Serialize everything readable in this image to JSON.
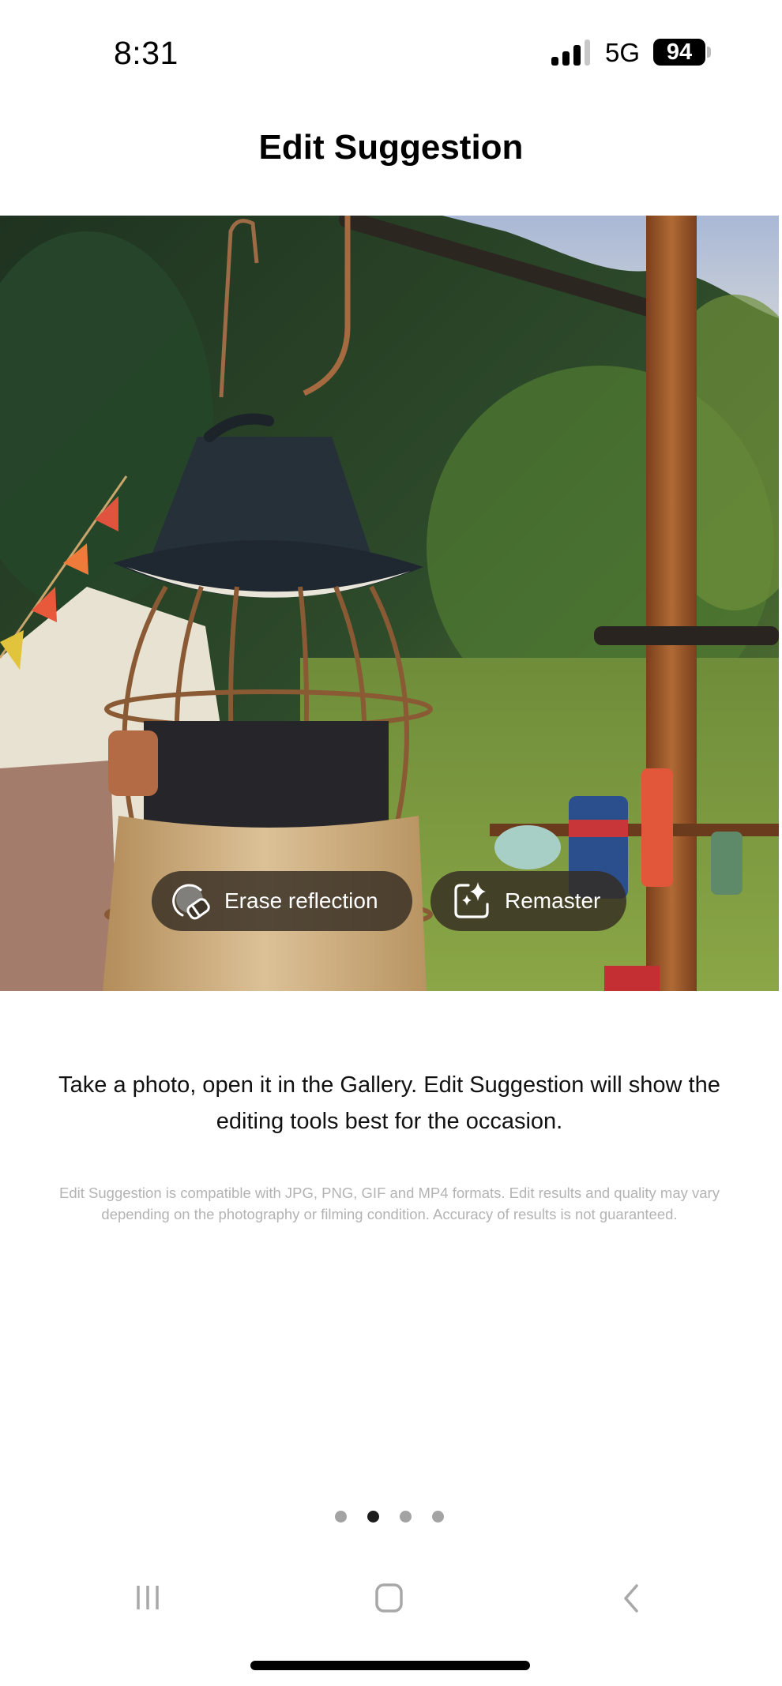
{
  "status_bar": {
    "time": "8:31",
    "network": "5G",
    "battery": "94",
    "signal_bars_filled": 3,
    "signal_bars_total": 4
  },
  "header": {
    "title": "Edit Suggestion"
  },
  "photo": {
    "description": "Lantern hanging outdoors at a campsite with trees and a tent",
    "suggestions": [
      {
        "label": "Erase reflection",
        "icon": "eraser-icon"
      },
      {
        "label": "Remaster",
        "icon": "sparkle-frame-icon"
      }
    ]
  },
  "content": {
    "description": "Take a photo, open it in the Gallery. Edit Suggestion will show the editing tools best for the occasion.",
    "disclaimer": "Edit Suggestion is compatible with JPG, PNG, GIF and MP4 formats. Edit results and quality may vary depending on the photography or filming condition. Accuracy of results is not guaranteed."
  },
  "pager": {
    "total": 4,
    "current": 2
  },
  "nav_bar": {
    "buttons": [
      "recents",
      "home",
      "back"
    ]
  },
  "colors": {
    "pill_bg": "#342c22",
    "dot_active": "#1e1e1e",
    "dot_inactive": "#a3a3a3",
    "disclaimer_text": "#b3b3b3"
  }
}
